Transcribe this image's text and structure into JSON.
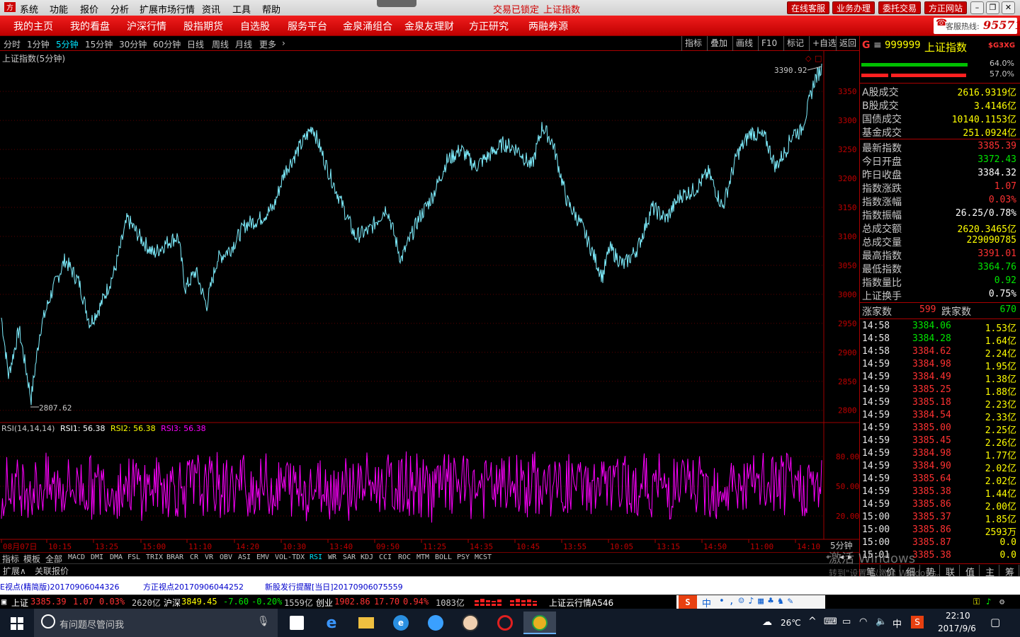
{
  "menu": {
    "items": [
      "系统",
      "功能",
      "报价",
      "分析",
      "扩展市场行情",
      "资讯",
      "工具",
      "帮助"
    ],
    "status_locked": "交易已锁定",
    "status_index": "上证指数",
    "right_buttons": [
      "在线客服",
      "业务办理",
      "委托交易",
      "方正网站"
    ]
  },
  "nav": {
    "items": [
      "我的主页",
      "我的看盘",
      "沪深行情",
      "股指期货",
      "自选股",
      "服务平台",
      "金泉涌组合",
      "金泉友理财",
      "方正研究",
      "两融券源"
    ],
    "hotline_label": "客服热线:",
    "hotline_number": "95571"
  },
  "periods": {
    "items": [
      "分时",
      "1分钟",
      "5分钟",
      "15分钟",
      "30分钟",
      "60分钟",
      "日线",
      "周线",
      "月线",
      "更多"
    ],
    "active": "5分钟",
    "tools": [
      "指标",
      "叠加",
      "画线",
      "F10",
      "标记",
      "+自选",
      "返回"
    ]
  },
  "chart_data": {
    "type": "line",
    "title": "上证指数(5分钟)",
    "y_ticks": [
      3350,
      3300,
      3250,
      3200,
      3150,
      3100,
      3050,
      3000,
      2950,
      2900,
      2850,
      2800
    ],
    "ylim": [
      2785,
      3410
    ],
    "x_ticks": [
      "08月07日",
      "10:15",
      "13:25",
      "15:00",
      "11:10",
      "14:20",
      "10:30",
      "13:40",
      "09:50",
      "11:25",
      "14:35",
      "10:45",
      "13:55",
      "10:05",
      "13:15",
      "14:50",
      "11:00",
      "14:10"
    ],
    "x_unit_label": "5分钟",
    "high_label": "3390.92",
    "low_label": "2807.62",
    "series": [
      {
        "x": [
          0,
          10,
          25,
          42,
          55,
          70,
          90,
          110,
          125,
          140,
          160,
          178,
          195,
          215,
          235,
          250,
          260,
          275,
          290,
          305,
          325,
          345,
          365,
          385,
          400,
          420,
          440,
          460,
          480,
          500,
          520,
          545,
          565,
          590,
          610,
          630,
          650,
          670,
          690,
          710,
          730,
          750,
          765,
          780,
          800,
          820,
          840,
          850,
          860,
          880,
          900,
          920,
          940,
          960,
          980,
          1000,
          1020,
          1040,
          1060,
          1080,
          1095,
          1110,
          1120,
          1130,
          1140,
          1150,
          1160
        ],
        "y": [
          2960,
          2860,
          2940,
          2820,
          2940,
          3000,
          3060,
          3020,
          2950,
          2980,
          3040,
          3130,
          3100,
          3070,
          3090,
          3100,
          3010,
          3040,
          2980,
          3060,
          3080,
          3120,
          3130,
          3150,
          3210,
          3250,
          3290,
          3220,
          3160,
          3100,
          3110,
          3150,
          3060,
          3130,
          3170,
          3230,
          3250,
          3220,
          3240,
          3260,
          3250,
          3220,
          3290,
          3260,
          3160,
          3120,
          3060,
          3030,
          3080,
          3050,
          3080,
          3150,
          3130,
          3170,
          3180,
          3210,
          3150,
          3240,
          3280,
          3270,
          3220,
          3250,
          3280,
          3280,
          3320,
          3370,
          3390
        ]
      }
    ],
    "rsi": {
      "label": "RSI(14,14,14)",
      "rsi1_label": "RSI1: 56.38",
      "rsi2_label": "RSI2: 56.38",
      "rsi3_label": "RSI3: 56.38",
      "y_ticks": [
        "80.00",
        "50.00",
        "20.00"
      ],
      "ylim": [
        0,
        100
      ]
    }
  },
  "indicator_tabs": {
    "items": [
      "指标",
      "模板",
      "全部",
      "MACD",
      "DMI",
      "DMA",
      "FSL",
      "TRIX",
      "BRAR",
      "CR",
      "VR",
      "OBV",
      "ASI",
      "EMV",
      "VOL-TDX",
      "RSI",
      "WR",
      "SAR",
      "KDJ",
      "CCI",
      "ROC",
      "MTM",
      "BOLL",
      "PSY",
      "MCST"
    ],
    "active": "RSI",
    "ext": [
      "扩展∧",
      "关联报价"
    ]
  },
  "quote": {
    "code": "999999",
    "name": "上证指数",
    "bar1_pct": "64.0%",
    "bar2_pct": "57.0%",
    "turnover": [
      {
        "label": "A股成交",
        "value": "2616.9319亿"
      },
      {
        "label": "B股成交",
        "value": "3.4146亿"
      },
      {
        "label": "国债成交",
        "value": "10140.1153亿"
      },
      {
        "label": "基金成交",
        "value": "251.0924亿"
      }
    ],
    "stats": [
      {
        "label": "最新指数",
        "value": "3385.39",
        "color": "red"
      },
      {
        "label": "今日开盘",
        "value": "3372.43",
        "color": "green"
      },
      {
        "label": "昨日收盘",
        "value": "3384.32",
        "color": "white"
      },
      {
        "label": "指数涨跌",
        "value": "1.07",
        "color": "red"
      },
      {
        "label": "指数涨幅",
        "value": "0.03%",
        "color": "red"
      },
      {
        "label": "指数振幅",
        "value": "26.25/0.78%",
        "color": "white"
      },
      {
        "label": "总成交额",
        "value": "2620.3465亿",
        "color": "yellow"
      },
      {
        "label": "总成交量",
        "value": "229090785",
        "color": "yellow"
      },
      {
        "label": "最高指数",
        "value": "3391.01",
        "color": "red"
      },
      {
        "label": "最低指数",
        "value": "3364.76",
        "color": "green"
      },
      {
        "label": "指数量比",
        "value": "0.92",
        "color": "green"
      },
      {
        "label": "上证换手",
        "value": "0.75%",
        "color": "white"
      }
    ],
    "up_label": "涨家数",
    "up_count": "599",
    "down_label": "跌家数",
    "down_count": "670"
  },
  "ticks": [
    {
      "t": "14:58",
      "p": "3384.06",
      "c": "green",
      "v": "1.53亿"
    },
    {
      "t": "14:58",
      "p": "3384.28",
      "c": "green",
      "v": "1.64亿"
    },
    {
      "t": "14:58",
      "p": "3384.62",
      "c": "red",
      "v": "2.24亿"
    },
    {
      "t": "14:59",
      "p": "3384.98",
      "c": "red",
      "v": "1.95亿"
    },
    {
      "t": "14:59",
      "p": "3384.49",
      "c": "red",
      "v": "1.38亿"
    },
    {
      "t": "14:59",
      "p": "3385.25",
      "c": "red",
      "v": "1.88亿"
    },
    {
      "t": "14:59",
      "p": "3385.18",
      "c": "red",
      "v": "2.23亿"
    },
    {
      "t": "14:59",
      "p": "3384.54",
      "c": "red",
      "v": "2.33亿"
    },
    {
      "t": "14:59",
      "p": "3385.00",
      "c": "red",
      "v": "2.25亿"
    },
    {
      "t": "14:59",
      "p": "3385.45",
      "c": "red",
      "v": "2.26亿"
    },
    {
      "t": "14:59",
      "p": "3384.98",
      "c": "red",
      "v": "1.77亿"
    },
    {
      "t": "14:59",
      "p": "3384.90",
      "c": "red",
      "v": "2.02亿"
    },
    {
      "t": "14:59",
      "p": "3385.64",
      "c": "red",
      "v": "2.02亿"
    },
    {
      "t": "14:59",
      "p": "3385.38",
      "c": "red",
      "v": "1.44亿"
    },
    {
      "t": "14:59",
      "p": "3385.86",
      "c": "red",
      "v": "2.00亿"
    },
    {
      "t": "15:00",
      "p": "3385.37",
      "c": "red",
      "v": "1.85亿"
    },
    {
      "t": "15:00",
      "p": "3385.86",
      "c": "red",
      "v": "2593万"
    },
    {
      "t": "15:00",
      "p": "3385.87",
      "c": "red",
      "v": "0.0"
    },
    {
      "t": "15:01",
      "p": "3385.38",
      "c": "red",
      "v": "0.0"
    }
  ],
  "bottom_tabs": [
    "笔",
    "价",
    "细",
    "势",
    "联",
    "值",
    "主",
    "筹"
  ],
  "watermark": {
    "line1": "激活 Windows",
    "line2": "转到\"设置\"以激活 Windows。"
  },
  "news": [
    "E视点(精简版)20170906044326",
    "方正视点20170906044252",
    "新股发行提醒[当日]20170906075559"
  ],
  "ticker": {
    "sh": {
      "name": "上证",
      "price": "3385.39",
      "chg": "1.07",
      "pct": "0.03%",
      "amt": "2620亿"
    },
    "hs": {
      "name": "沪深",
      "price": "3849.45",
      "chg": "-7.60",
      "pct": "-0.20%",
      "amt": "1559亿"
    },
    "cy": {
      "name": "创业",
      "price": "1902.86",
      "chg": "17.70",
      "pct": "0.94%",
      "amt": "1083亿"
    },
    "cloud": "上证云行情A546"
  },
  "taskbar": {
    "search_placeholder": "有问题尽管问我",
    "weather": "26℃",
    "ime": "中",
    "time": "22:10",
    "date": "2017/9/6"
  }
}
